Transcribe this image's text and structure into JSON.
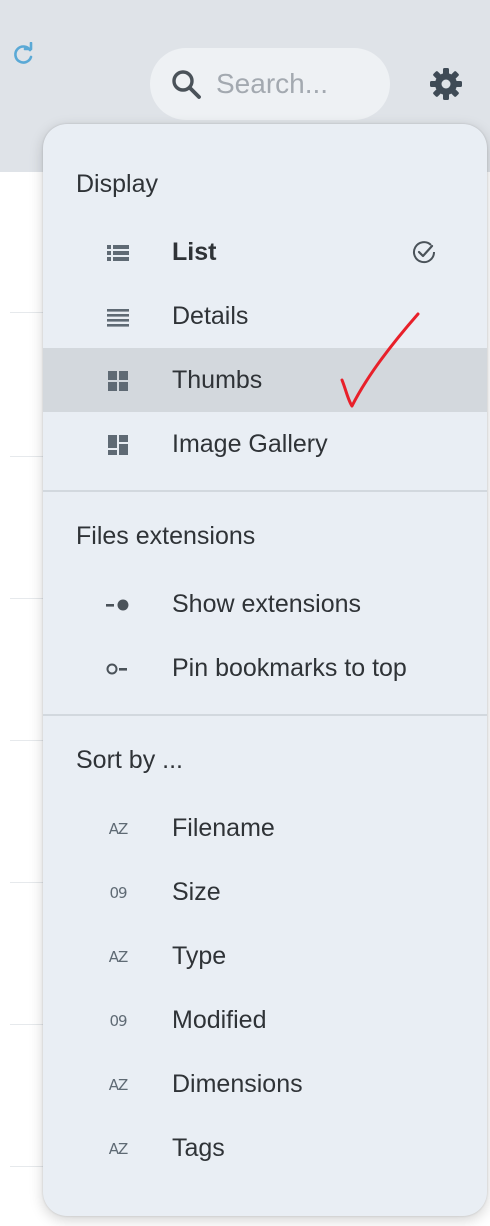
{
  "search": {
    "placeholder": "Search..."
  },
  "icons": {
    "reload": "reload-icon",
    "search": "search-icon",
    "settings": "gear-icon"
  },
  "menu": {
    "display": {
      "title": "Display",
      "items": [
        {
          "label": "List",
          "icon": "list-icon",
          "checked": true
        },
        {
          "label": "Details",
          "icon": "details-lines-icon"
        },
        {
          "label": "Thumbs",
          "icon": "thumbs-grid-icon",
          "highlighted": true
        },
        {
          "label": "Image Gallery",
          "icon": "gallery-icon"
        }
      ]
    },
    "extensions": {
      "title": "Files extensions",
      "items": [
        {
          "label": "Show extensions",
          "icon": "toggle-on-icon"
        },
        {
          "label": "Pin bookmarks to top",
          "icon": "toggle-off-icon"
        }
      ]
    },
    "sort": {
      "title": "Sort by ...",
      "items": [
        {
          "label": "Filename",
          "icon": "sort-alpha-icon",
          "glyph": "AZ"
        },
        {
          "label": "Size",
          "icon": "sort-numeric-icon",
          "glyph": "09"
        },
        {
          "label": "Type",
          "icon": "sort-alpha-icon",
          "glyph": "AZ"
        },
        {
          "label": "Modified",
          "icon": "sort-numeric-icon",
          "glyph": "09"
        },
        {
          "label": "Dimensions",
          "icon": "sort-alpha-icon",
          "glyph": "AZ"
        },
        {
          "label": "Tags",
          "icon": "sort-alpha-icon",
          "glyph": "AZ"
        }
      ]
    }
  },
  "colors": {
    "accent": "#5aa9d6",
    "annotation": "#e8202a",
    "highlight": "#d3d8dd",
    "menu_bg": "#e9eef4"
  }
}
